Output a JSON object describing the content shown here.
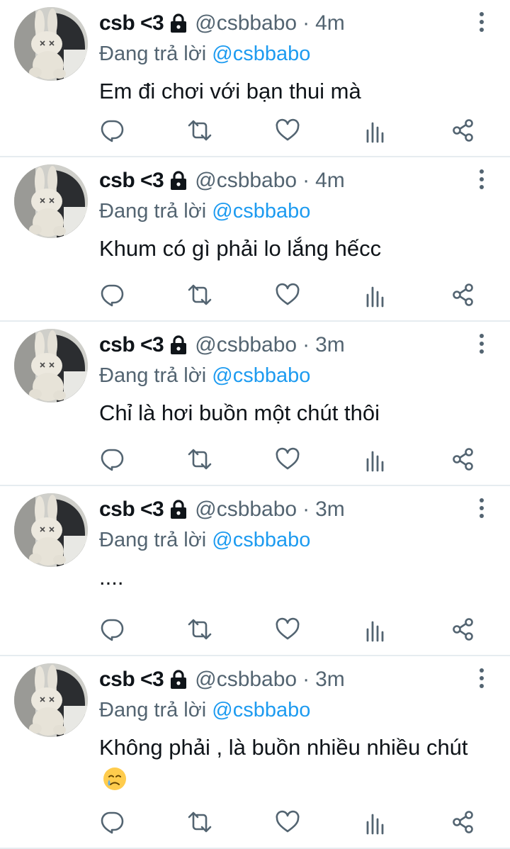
{
  "colors": {
    "text": "#0f1419",
    "muted": "#536471",
    "link": "#1d9bf0",
    "divider": "#e6ecf0"
  },
  "icons": {
    "lock": "lock-icon",
    "more": "more-vertical-icon",
    "reply": "reply-icon",
    "retweet": "retweet-icon",
    "like": "heart-icon",
    "views": "analytics-icon",
    "share": "share-icon",
    "emoji": "crying-face-emoji"
  },
  "tweets": [
    {
      "display_name": "csb <3",
      "handle": "@csbbabo",
      "separator": "·",
      "time": "4m",
      "reply_prefix": "Đang trả lời",
      "reply_handle": "@csbbabo",
      "text": "Em đi chơi với bạn thui mà"
    },
    {
      "display_name": "csb <3",
      "handle": "@csbbabo",
      "separator": "·",
      "time": "4m",
      "reply_prefix": "Đang trả lời",
      "reply_handle": "@csbbabo",
      "text": "Khum có gì phải lo lắng hếcc"
    },
    {
      "display_name": "csb <3",
      "handle": "@csbbabo",
      "separator": "·",
      "time": "3m",
      "reply_prefix": "Đang trả lời",
      "reply_handle": "@csbbabo",
      "text": "Chỉ là hơi buồn một chút thôi"
    },
    {
      "display_name": "csb <3",
      "handle": "@csbbabo",
      "separator": "·",
      "time": "3m",
      "reply_prefix": "Đang trả lời",
      "reply_handle": "@csbbabo",
      "text": "...."
    },
    {
      "display_name": "csb <3",
      "handle": "@csbbabo",
      "separator": "·",
      "time": "3m",
      "reply_prefix": "Đang trả lời",
      "reply_handle": "@csbbabo",
      "text": "Không phải , là buồn nhiều nhiều chút"
    }
  ]
}
